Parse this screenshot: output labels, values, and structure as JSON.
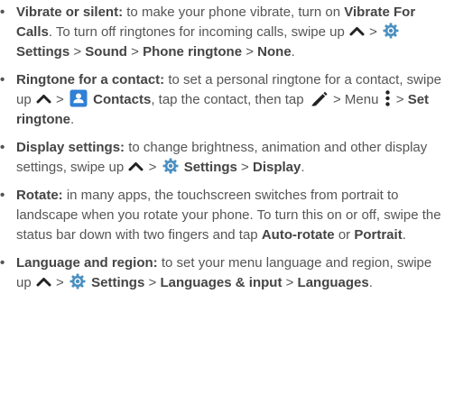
{
  "items": [
    {
      "title": "Vibrate or silent:",
      "t1": "to make your phone vibrate, turn on",
      "b1": "Vibrate For Calls",
      "t2": ". To turn off ringtones for incoming calls, swipe up",
      "sep1": ">",
      "b2": "Settings",
      "sep2": ">",
      "b3": "Sound",
      "sep3": ">",
      "b4": "Phone ringtone",
      "sep4": ">",
      "b5": "None",
      "t3": "."
    },
    {
      "title": "Ringtone for a contact:",
      "t1": "to set a personal ringtone for a contact, swipe up",
      "sep1": ">",
      "b1": "Contacts",
      "t2": ", tap the contact, then tap",
      "t3": "> Menu",
      "sep2": ">",
      "b2": "Set ringtone",
      "t4": "."
    },
    {
      "title": "Display settings:",
      "t1": "to change brightness, animation and other display settings, swipe up",
      "sep1": ">",
      "b1": "Settings",
      "sep2": ">",
      "b2": "Display",
      "t2": "."
    },
    {
      "title": "Rotate:",
      "t1": "in many apps, the touchscreen switches from portrait to landscape when you rotate your phone. To turn this on or off, swipe the status bar down with two fingers and tap",
      "b1": "Auto-rotate",
      "t2": "or",
      "b2": "Portrait",
      "t3": "."
    },
    {
      "title": "Language and region:",
      "t1": "to set your menu language and region, swipe up",
      "sep1": ">",
      "b1": "Settings",
      "sep2": ">",
      "b2": "Languages & input",
      "sep3": ">",
      "b3": "Languages",
      "t2": "."
    }
  ],
  "bullet_char": "•",
  "icons": {
    "swipe_up": "chevron-up-icon",
    "settings": "gear-icon",
    "contacts": "contacts-app-icon",
    "edit": "pencil-icon",
    "menu": "kebab-menu-icon"
  },
  "colors": {
    "body_text": "#555555",
    "bold_text": "#444444",
    "gear_icon": "#4a8fbf",
    "contacts_icon": "#2f80d6"
  }
}
